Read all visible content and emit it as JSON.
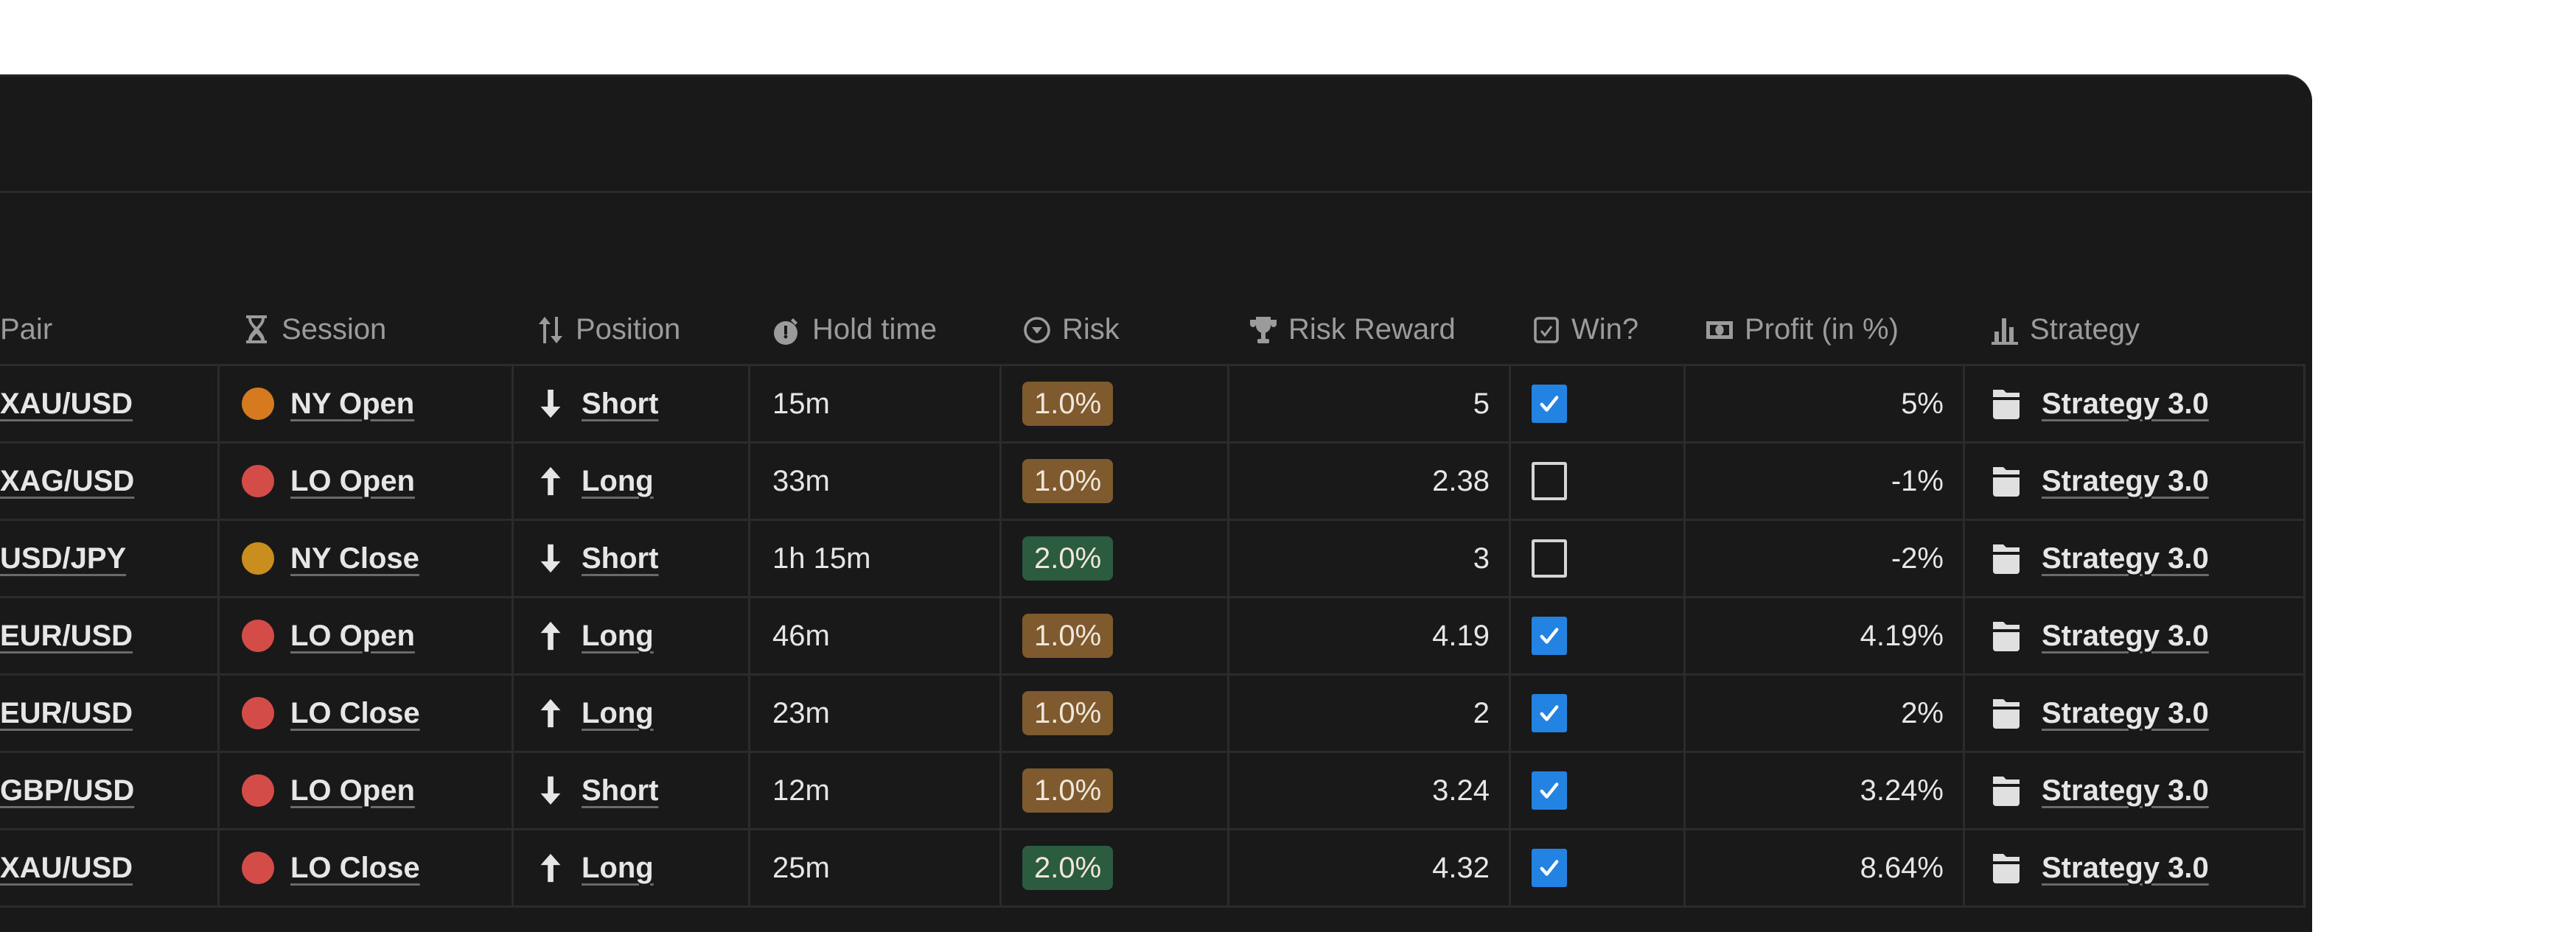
{
  "colors": {
    "panel_bg": "#191919",
    "checkbox_blue": "#2383e2",
    "badge_brown": "#7f5a2f",
    "badge_green": "#2b5c40",
    "dot_ny_open": "#d57a1f",
    "dot_ny_close": "#c98e1e",
    "dot_lo": "#d44c47"
  },
  "table": {
    "columns": [
      {
        "key": "pair",
        "label": "Pair",
        "icon": ""
      },
      {
        "key": "session",
        "label": "Session",
        "icon": "hourglass-icon"
      },
      {
        "key": "position",
        "label": "Position",
        "icon": "up-down-arrows-icon"
      },
      {
        "key": "hold_time",
        "label": "Hold time",
        "icon": "stopwatch-icon"
      },
      {
        "key": "risk",
        "label": "Risk",
        "icon": "circle-chevron-down-icon"
      },
      {
        "key": "risk_reward",
        "label": "Risk Reward",
        "icon": "trophy-icon"
      },
      {
        "key": "win",
        "label": "Win?",
        "icon": "checkbox-icon"
      },
      {
        "key": "profit",
        "label": "Profit (in %)",
        "icon": "banknote-icon"
      },
      {
        "key": "strategy",
        "label": "Strategy",
        "icon": "bar-chart-icon"
      }
    ],
    "rows": [
      {
        "pair": "XAU/USD",
        "session": "NY Open",
        "session_color": "#d57a1f",
        "position": "Short",
        "direction": "down",
        "hold_time": "15m",
        "risk": "1.0%",
        "risk_color": "#7f5a2f",
        "risk_reward": "5",
        "win": true,
        "profit": "5%",
        "strategy": "Strategy 3.0"
      },
      {
        "pair": "XAG/USD",
        "session": "LO Open",
        "session_color": "#d44c47",
        "position": "Long",
        "direction": "up",
        "hold_time": "33m",
        "risk": "1.0%",
        "risk_color": "#7f5a2f",
        "risk_reward": "2.38",
        "win": false,
        "profit": "-1%",
        "strategy": "Strategy 3.0"
      },
      {
        "pair": "USD/JPY",
        "session": "NY Close",
        "session_color": "#c98e1e",
        "position": "Short",
        "direction": "down",
        "hold_time": "1h 15m",
        "risk": "2.0%",
        "risk_color": "#2b5c40",
        "risk_reward": "3",
        "win": false,
        "profit": "-2%",
        "strategy": "Strategy 3.0"
      },
      {
        "pair": "EUR/USD",
        "session": "LO Open",
        "session_color": "#d44c47",
        "position": "Long",
        "direction": "up",
        "hold_time": "46m",
        "risk": "1.0%",
        "risk_color": "#7f5a2f",
        "risk_reward": "4.19",
        "win": true,
        "profit": "4.19%",
        "strategy": "Strategy 3.0"
      },
      {
        "pair": "EUR/USD",
        "session": "LO Close",
        "session_color": "#d44c47",
        "position": "Long",
        "direction": "up",
        "hold_time": "23m",
        "risk": "1.0%",
        "risk_color": "#7f5a2f",
        "risk_reward": "2",
        "win": true,
        "profit": "2%",
        "strategy": "Strategy 3.0"
      },
      {
        "pair": "GBP/USD",
        "session": "LO Open",
        "session_color": "#d44c47",
        "position": "Short",
        "direction": "down",
        "hold_time": "12m",
        "risk": "1.0%",
        "risk_color": "#7f5a2f",
        "risk_reward": "3.24",
        "win": true,
        "profit": "3.24%",
        "strategy": "Strategy 3.0"
      },
      {
        "pair": "XAU/USD",
        "session": "LO Close",
        "session_color": "#d44c47",
        "position": "Long",
        "direction": "up",
        "hold_time": "25m",
        "risk": "2.0%",
        "risk_color": "#2b5c40",
        "risk_reward": "4.32",
        "win": true,
        "profit": "8.64%",
        "strategy": "Strategy 3.0"
      }
    ]
  }
}
